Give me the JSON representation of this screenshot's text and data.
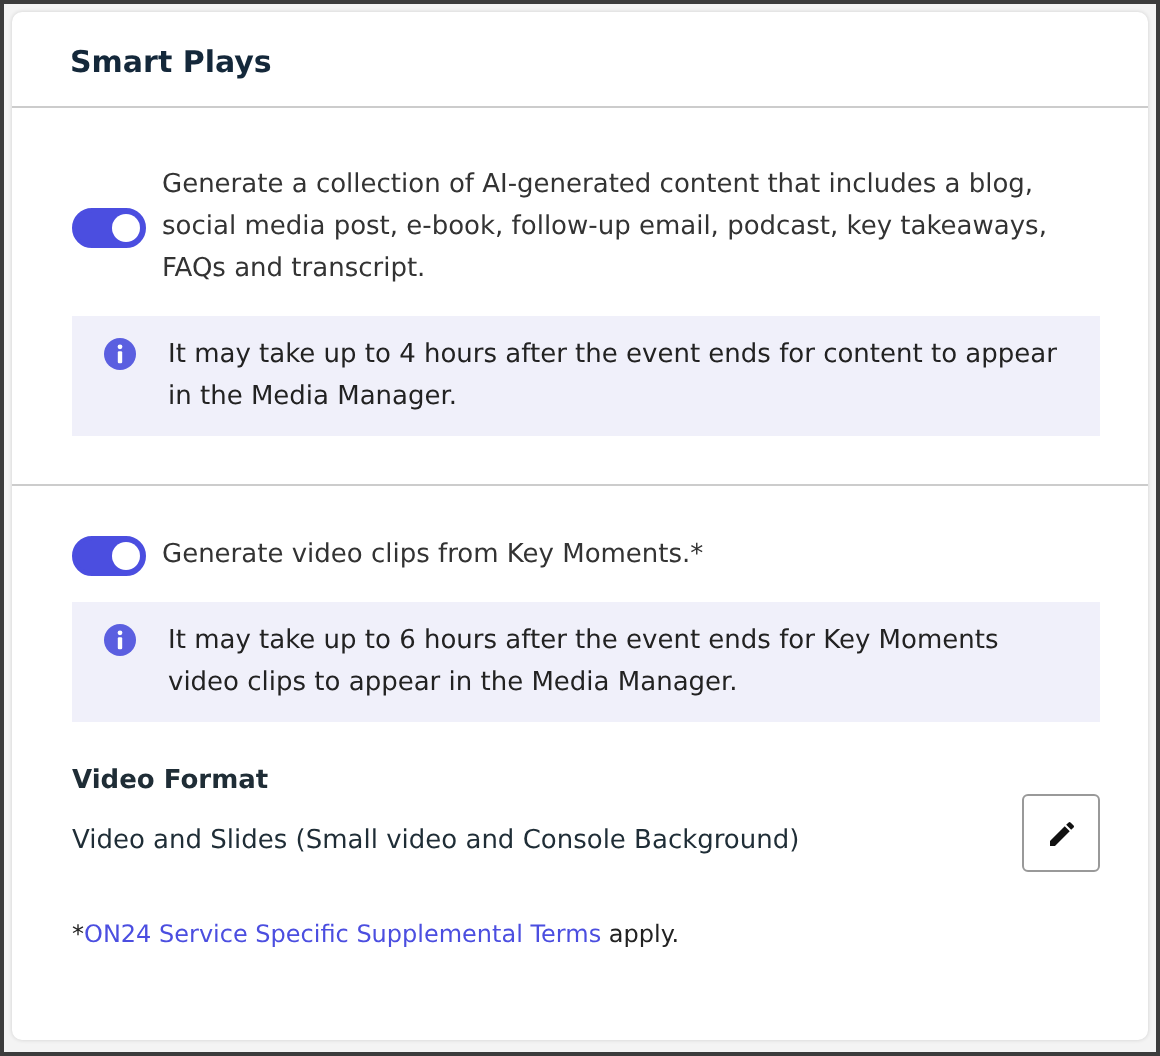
{
  "panel": {
    "title": "Smart Plays"
  },
  "sections": [
    {
      "toggle": {
        "on": true
      },
      "label": "Generate a collection of AI-generated content that includes a blog, social media post, e-book, follow-up email, podcast, key takeaways, FAQs and transcript.",
      "info": "It may take up to 4 hours after the event ends for content to appear in the Media Manager."
    },
    {
      "toggle": {
        "on": true
      },
      "label": "Generate video clips from Key Moments.*",
      "info": "It may take up to 6 hours after the event ends for Key Moments video clips to appear in the Media Manager."
    }
  ],
  "video_format": {
    "heading": "Video Format",
    "value": "Video and Slides (Small video and Console Background)"
  },
  "footnote": {
    "prefix": "*",
    "link": "ON24 Service Specific Supplemental Terms",
    "suffix": " apply."
  }
}
